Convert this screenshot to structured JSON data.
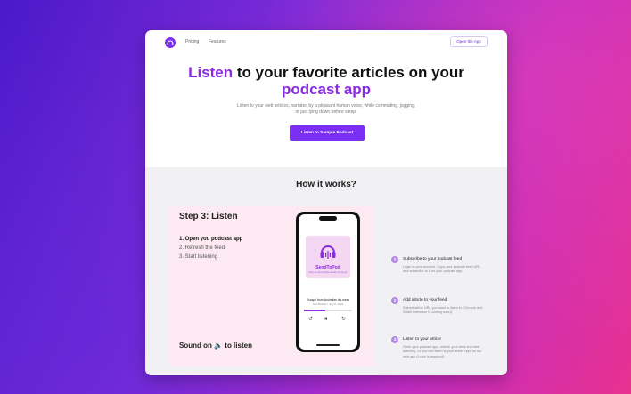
{
  "nav": {
    "links": [
      "Pricing",
      "Features"
    ],
    "open_app": "Open the App"
  },
  "hero": {
    "title_accent": "Listen",
    "title_rest": " to your favorite articles on your",
    "title_line2": "podcast app",
    "subtitle": "Listen to your web articles, narrated by a pleasant human voice, while commuting, jogging, or just lying down before sleep.",
    "cta": "Listen to Sample Podcast"
  },
  "how": {
    "title": "How it works?",
    "step_title": "Step 3: Listen",
    "step_items": [
      "1. Open you podcast app",
      "2. Refresh the feed",
      "3. Start listening"
    ],
    "sound_note": "Sound on 🔈 to listen",
    "phone": {
      "podcast_name": "SendToPod",
      "podcast_tagline": "listen to your favorite articles on the go",
      "episode_title": "Escape from Australian dis-mess",
      "episode_meta": "SendToPod • July 8, 2023",
      "progress": 0.45,
      "controls": [
        "↺",
        "⏸",
        "↻"
      ]
    },
    "steps": [
      {
        "num": "1",
        "title": "Subscribe to your podcast feed",
        "desc": "Login to your account. Copy your podcast feed URL and subscribe to it on your podcast app."
      },
      {
        "num": "2",
        "title": "Add article to your feed",
        "desc": "Submit article URL you want to listen to (Chrome and Safari extension is coming soon)."
      },
      {
        "num": "3",
        "title": "Listen to your article",
        "desc": "Open your podcast app, refresh your feed and start listening. Or you can listen to your article right on our web app (Login is required)."
      }
    ]
  },
  "colors": {
    "accent": "#8a2be2",
    "button": "#7b2ff2",
    "panel": "#fce9f1"
  }
}
